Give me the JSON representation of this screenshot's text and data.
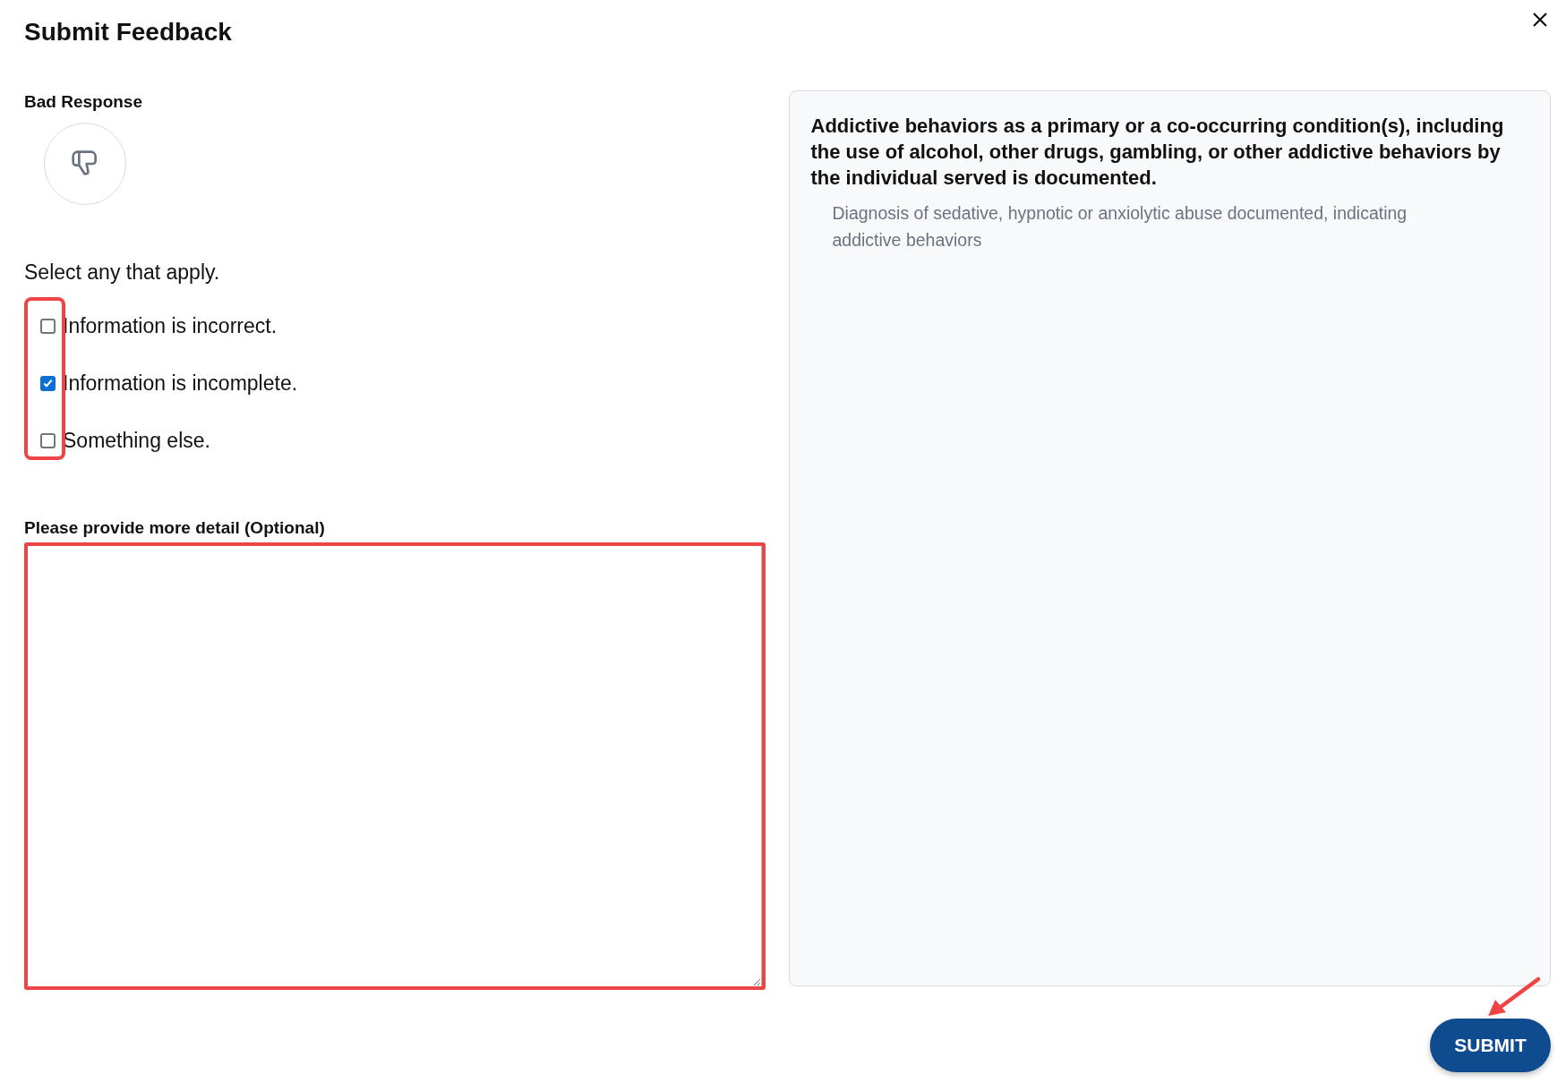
{
  "dialog": {
    "title": "Submit Feedback"
  },
  "rating": {
    "label": "Bad Response"
  },
  "prompt": "Select any that apply.",
  "options": [
    {
      "label": "Information is incorrect.",
      "checked": false
    },
    {
      "label": "Information is incomplete.",
      "checked": true
    },
    {
      "label": "Something else.",
      "checked": false
    }
  ],
  "detail": {
    "label": "Please provide more detail (Optional)"
  },
  "panel": {
    "heading": "Addictive behaviors as a primary or a co-occurring condition(s), including the use of alcohol, other drugs, gambling, or other addictive behaviors by the individual served is documented.",
    "text": "Diagnosis of sedative, hypnotic or anxiolytic abuse documented, indicating addictive behaviors"
  },
  "submit_button": "SUBMIT"
}
